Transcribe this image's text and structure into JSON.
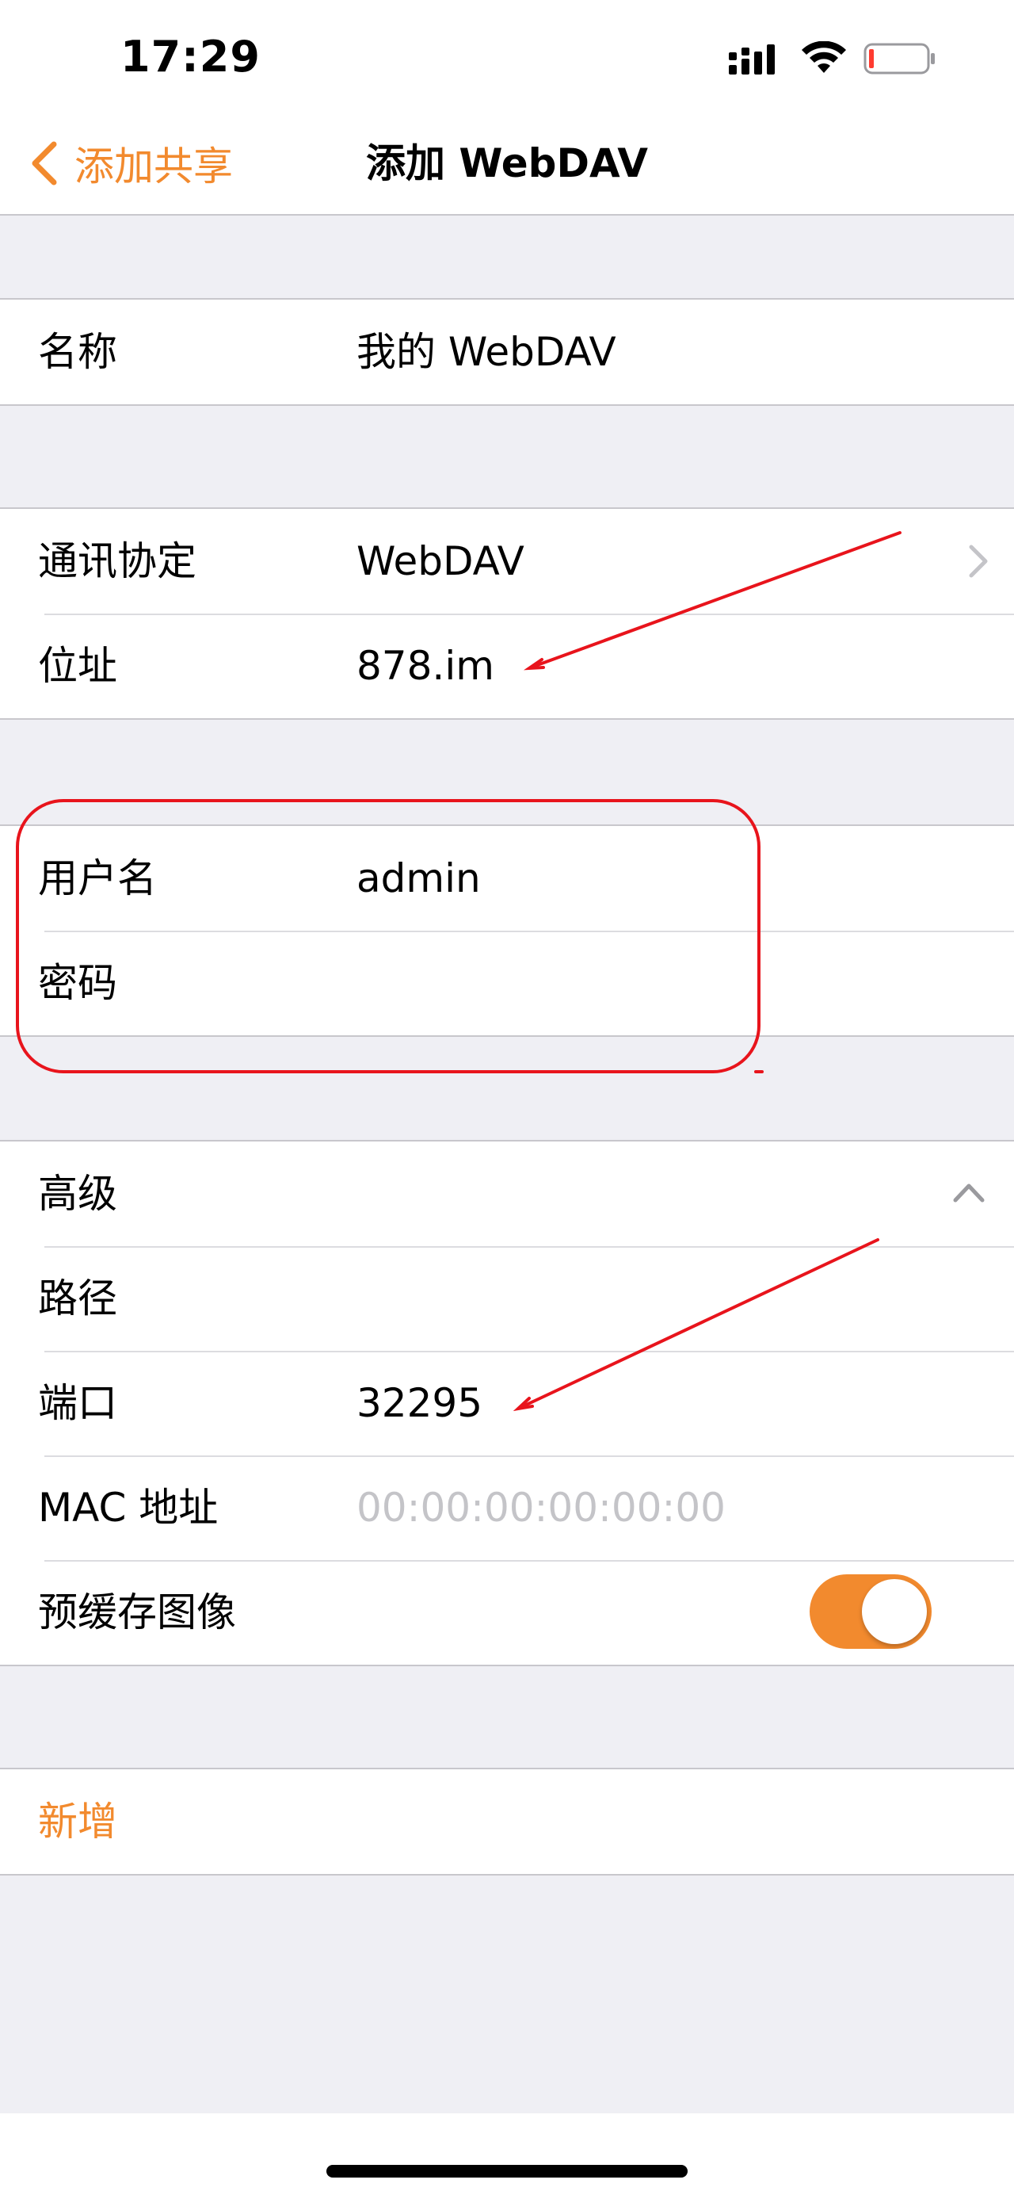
{
  "status_bar": {
    "time": "17:29",
    "icons": [
      "cellular-signal-icon",
      "wifi-icon",
      "battery-low-icon"
    ],
    "battery_color": "#ff3b30"
  },
  "nav": {
    "back_label": "添加共享",
    "title": "添加 WebDAV"
  },
  "sections": {
    "name": {
      "label": "名称",
      "value": "我的 WebDAV"
    },
    "connection": {
      "protocol_label": "通讯协定",
      "protocol_value": "WebDAV",
      "address_label": "位址",
      "address_value": "878.im"
    },
    "credentials": {
      "username_label": "用户名",
      "username_value": "admin",
      "password_label": "密码",
      "password_value": ""
    },
    "advanced": {
      "header_label": "高级",
      "path_label": "路径",
      "path_value": "",
      "port_label": "端口",
      "port_value": "32295",
      "mac_label": "MAC 地址",
      "mac_placeholder": "00:00:00:00:00:00",
      "precache_label": "预缓存图像",
      "precache_on": true
    },
    "actions": {
      "add_label": "新增"
    }
  },
  "colors": {
    "accent": "#f28a2e",
    "annotation": "#e8141c",
    "background": "#efeff4"
  }
}
